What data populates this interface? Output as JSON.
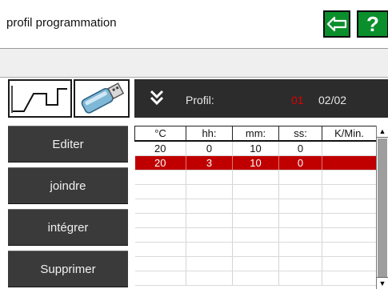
{
  "header": {
    "title": "profil programmation"
  },
  "toolbar": {
    "back_icon": "arrow-left-icon",
    "help_label": "?"
  },
  "profile": {
    "label": "Profil:",
    "current": "01",
    "count": "02/02",
    "collapse_icon": "double-chevron-down-icon"
  },
  "icons": {
    "curve": "temperature-curve-icon",
    "usb": "usb-drive-icon"
  },
  "actions": {
    "edit": "Editer",
    "join": "joindre",
    "insert": "intégrer",
    "delete": "Supprimer"
  },
  "table": {
    "columns": [
      "°C",
      "hh:",
      "mm:",
      "ss:",
      "K/Min."
    ],
    "rows": [
      [
        "20",
        "0",
        "10",
        "0",
        ""
      ],
      [
        "20",
        "3",
        "10",
        "0",
        ""
      ]
    ],
    "selected_row": 1
  },
  "colors": {
    "accent": "#0b8f2c",
    "selection": "#c00000",
    "dark": "#3a3a3a"
  }
}
